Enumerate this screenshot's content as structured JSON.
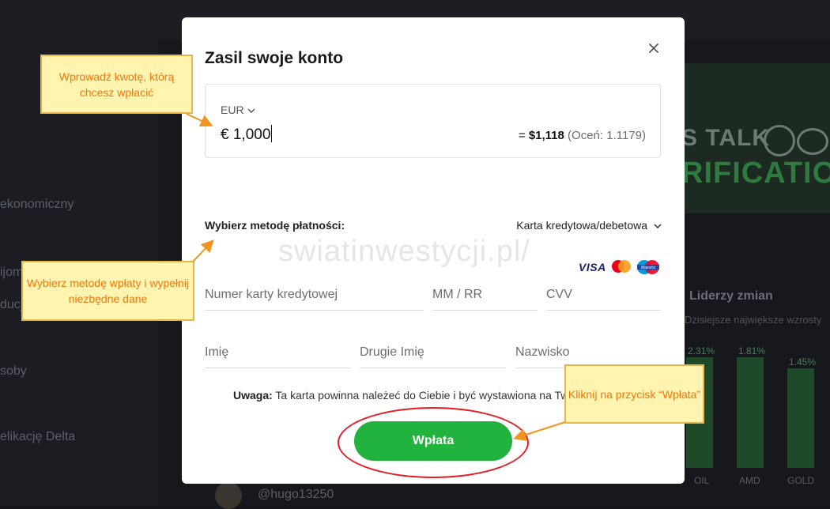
{
  "background": {
    "sidebar_items": [
      "ekonomiczny",
      "ijom",
      "ducj",
      "soby",
      "elikację Delta"
    ],
    "banner_line1": "S TALK",
    "banner_line2": "RIFICATION",
    "leaders_title": "Liderzy zmian",
    "leaders_subtitle": "Dzisiejsze największe wzrosty",
    "leaders_percents": [
      "2.31%",
      "1.81%",
      "1.45%"
    ],
    "leaders_tickers": [
      "OIL",
      "AMD",
      "GOLD"
    ],
    "user_handle": "@hugo13250"
  },
  "modal": {
    "title": "Zasil swoje konto",
    "close_icon": "close-icon",
    "amount": {
      "currency": "EUR",
      "value": "€ 1,000",
      "converted_prefix": "= ",
      "converted": "$1,118",
      "rate": "(Oceń: 1.1179)"
    },
    "payment": {
      "label": "Wybierz metodę płatności:",
      "selected": "Karta kredytowa/debetowa",
      "card_brands": [
        "VISA",
        "Mastercard",
        "Maestro"
      ],
      "card_number_placeholder": "Numer karty kredytowej",
      "expiry_placeholder": "MM / RR",
      "cvv_placeholder": "CVV",
      "first_name_placeholder": "Imię",
      "middle_name_placeholder": "Drugie Imię",
      "last_name_placeholder": "Nazwisko"
    },
    "notice_label": "Uwaga:",
    "notice_text": " Ta karta powinna należeć do Ciebie i być wystawiona na Tw",
    "submit_label": "Wpłata"
  },
  "watermark": "swiatinwestycji.pl/",
  "callouts": {
    "amount": "Wprowadź kwotę, którą chcesz wpłacić",
    "method": "Wybierz metodę wpłaty i wypełnij niezbędne dane",
    "submit": "Kliknij na przycisk “Wpłata”"
  },
  "colors": {
    "accent_green": "#22b33e",
    "callout_fill": "#fff4b0",
    "callout_text": "#f0780a",
    "highlight_ring": "#e31b23"
  }
}
